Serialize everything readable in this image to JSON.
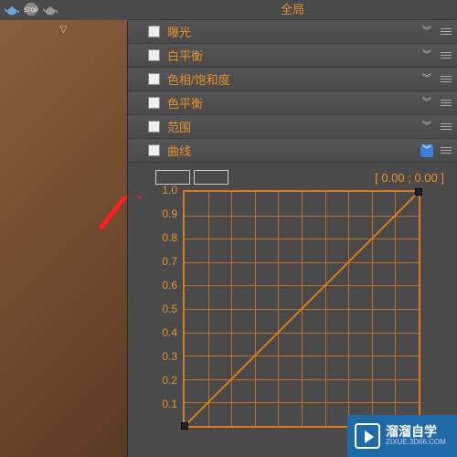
{
  "header": {
    "title": "全局"
  },
  "sections": [
    {
      "label": "曝光"
    },
    {
      "label": "白平衡"
    },
    {
      "label": "色相/饱和度"
    },
    {
      "label": "色平衡"
    },
    {
      "label": "范围"
    },
    {
      "label": "曲线"
    }
  ],
  "curves": {
    "readout": "[ 0.00 ; 0.00 ]"
  },
  "chart_data": {
    "type": "line",
    "title": "",
    "xlabel": "",
    "ylabel": "",
    "xlim": [
      0.0,
      1.0
    ],
    "ylim": [
      0.0,
      1.0
    ],
    "y_ticks": [
      "1.0",
      "0.9",
      "0.8",
      "0.7",
      "0.6",
      "0.5",
      "0.4",
      "0.3",
      "0.2",
      "0.1"
    ],
    "series": [
      {
        "name": "curve",
        "x": [
          0.0,
          1.0
        ],
        "y": [
          0.0,
          1.0
        ]
      }
    ],
    "grid": true
  },
  "watermark": {
    "title": "溜溜自学",
    "sub": "ZIXUE.3D66.COM"
  },
  "colors": {
    "accent": "#e89030",
    "panel": "#4a4a4a",
    "grid": "#d97b1f",
    "arrow": "#ff1e1e",
    "brand": "#1e6aa8"
  }
}
